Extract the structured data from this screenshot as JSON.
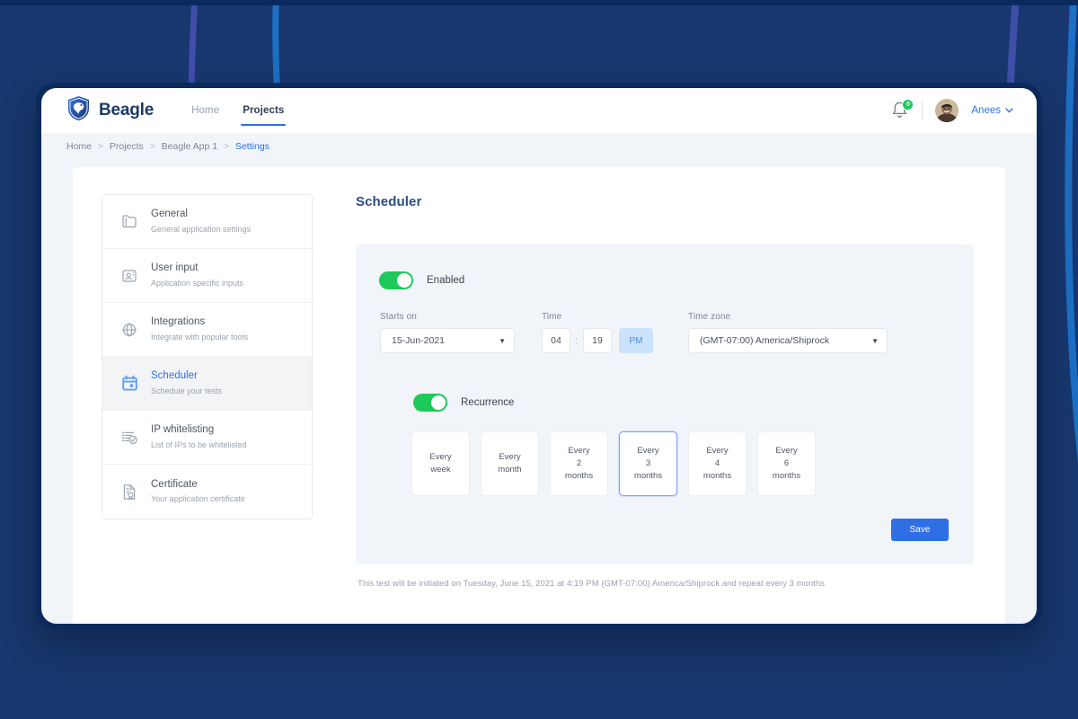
{
  "background": {
    "base_color": "#17376e",
    "top_strip_color": "#0a2a5e",
    "curve_colors": [
      "#3f4fa8",
      "#1d6fc4",
      "#3f4fa8",
      "#1d6fc4"
    ]
  },
  "navbar": {
    "brand_name": "Beagle",
    "brand_icon": "shield-dog-logo-icon",
    "tabs": [
      {
        "label": "Home",
        "active": false
      },
      {
        "label": "Projects",
        "active": true
      }
    ],
    "notification_icon": "bell-icon",
    "notification_count": "0",
    "notification_badge_color": "#1ec95b",
    "avatar_icon": "user-avatar-photo",
    "user_name": "Anees",
    "user_chevron_icon": "chevron-down-icon",
    "accent_color": "#2f6fe4"
  },
  "breadcrumb": {
    "separator": ">",
    "items": [
      {
        "label": "Home",
        "current": false
      },
      {
        "label": "Projects",
        "current": false
      },
      {
        "label": "Beagle App 1",
        "current": false
      },
      {
        "label": "Settings",
        "current": true
      }
    ]
  },
  "settings_nav": {
    "items": [
      {
        "icon": "folder-icon",
        "title": "General",
        "subtitle": "General application settings",
        "active": false
      },
      {
        "icon": "user-input-icon",
        "title": "User input",
        "subtitle": "Application specific inputs",
        "active": false
      },
      {
        "icon": "integrations-globe-icon",
        "title": "Integrations",
        "subtitle": "Integrate with popular tools",
        "active": false
      },
      {
        "icon": "calendar-icon",
        "title": "Scheduler",
        "subtitle": "Schedule your tests",
        "active": true
      },
      {
        "icon": "ip-whitelist-icon",
        "title": "IP whitelisting",
        "subtitle": "List of IPs to be whitelisted",
        "active": false
      },
      {
        "icon": "certificate-icon",
        "title": "Certificate",
        "subtitle": "Your application certificate",
        "active": false
      }
    ]
  },
  "main": {
    "page_title": "Scheduler",
    "enabled_toggle": {
      "label": "Enabled",
      "state": "on",
      "on_color": "#1ec95b"
    },
    "starts_on": {
      "label": "Starts on",
      "value": "15-Jun-2021",
      "caret_icon": "caret-down-icon"
    },
    "time": {
      "label": "Time",
      "hour": "04",
      "separator": ":",
      "minute": "19",
      "meridiem": "PM",
      "meridiem_active_color": "#cae3fb"
    },
    "time_zone": {
      "label": "Time zone",
      "value": "(GMT-07:00) America/Shiprock",
      "caret_icon": "caret-down-icon"
    },
    "recurrence_toggle": {
      "label": "Recurrence",
      "state": "on",
      "on_color": "#1ec95b"
    },
    "recurrence_options": [
      {
        "line1": "Every",
        "line2": "week",
        "line3": "",
        "selected": false
      },
      {
        "line1": "Every",
        "line2": "month",
        "line3": "",
        "selected": false
      },
      {
        "line1": "Every",
        "line2": "2",
        "line3": "months",
        "selected": false
      },
      {
        "line1": "Every",
        "line2": "3",
        "line3": "months",
        "selected": true
      },
      {
        "line1": "Every",
        "line2": "4",
        "line3": "months",
        "selected": false
      },
      {
        "line1": "Every",
        "line2": "6",
        "line3": "months",
        "selected": false
      }
    ],
    "save_label": "Save",
    "save_color": "#2f6fe4",
    "summary_text": "This test will be initiated on Tuesday, June 15, 2021 at 4:19 PM (GMT-07:00) America/Shiprock and repeat every 3 months"
  }
}
